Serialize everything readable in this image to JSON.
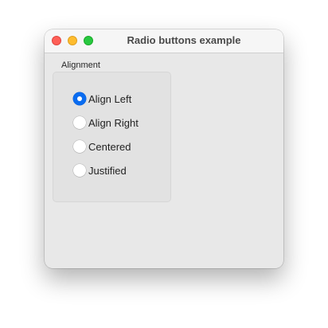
{
  "window": {
    "title": "Radio buttons example"
  },
  "group": {
    "label": "Alignment",
    "options": [
      {
        "label": "Align Left",
        "checked": true
      },
      {
        "label": "Align Right",
        "checked": false
      },
      {
        "label": "Centered",
        "checked": false
      },
      {
        "label": "Justified",
        "checked": false
      }
    ]
  },
  "colors": {
    "accent": "#0a6cf0",
    "close": "#fe5f57",
    "minimize": "#febc2e",
    "maximize": "#28c840"
  }
}
